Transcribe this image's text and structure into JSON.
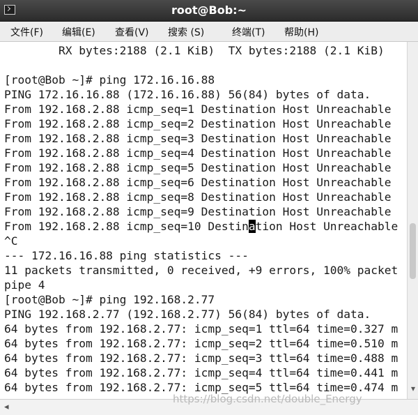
{
  "window": {
    "title": "root@Bob:~"
  },
  "menu": [
    "文件(F)",
    "编辑(E)",
    "查看(V)",
    "搜索 (S)",
    "终端(T)",
    "帮助(H)"
  ],
  "terminal": {
    "lines": [
      "        RX bytes:2188 (2.1 KiB)  TX bytes:2188 (2.1 KiB)",
      "",
      "[root@Bob ~]# ping 172.16.16.88",
      "PING 172.16.16.88 (172.16.16.88) 56(84) bytes of data.",
      "From 192.168.2.88 icmp_seq=1 Destination Host Unreachable",
      "From 192.168.2.88 icmp_seq=2 Destination Host Unreachable",
      "From 192.168.2.88 icmp_seq=3 Destination Host Unreachable",
      "From 192.168.2.88 icmp_seq=4 Destination Host Unreachable",
      "From 192.168.2.88 icmp_seq=5 Destination Host Unreachable",
      "From 192.168.2.88 icmp_seq=6 Destination Host Unreachable",
      "From 192.168.2.88 icmp_seq=8 Destination Host Unreachable",
      "From 192.168.2.88 icmp_seq=9 Destination Host Unreachable",
      "From 192.168.2.88 icmp_seq=10 Destination Host Unreachable",
      "^C",
      "--- 172.16.16.88 ping statistics ---",
      "11 packets transmitted, 0 received, +9 errors, 100% packet",
      "pipe 4",
      "[root@Bob ~]# ping 192.168.2.77",
      "PING 192.168.2.77 (192.168.2.77) 56(84) bytes of data.",
      "64 bytes from 192.168.2.77: icmp_seq=1 ttl=64 time=0.327 m",
      "64 bytes from 192.168.2.77: icmp_seq=2 ttl=64 time=0.510 m",
      "64 bytes from 192.168.2.77: icmp_seq=3 ttl=64 time=0.488 m",
      "64 bytes from 192.168.2.77: icmp_seq=4 ttl=64 time=0.441 m",
      "64 bytes from 192.168.2.77: icmp_seq=5 ttl=64 time=0.474 m"
    ],
    "cursor": {
      "line": 12,
      "before": "From 192.168.2.88 icmp_seq=10 Destin",
      "char": "a",
      "after": "tion Host Unreachable"
    }
  },
  "watermark": "https://blog.csdn.net/double_Energy",
  "icons": {
    "terminal": "terminal-icon",
    "scroll_down": "chevron-down-icon",
    "scroll_left": "chevron-left-icon"
  }
}
